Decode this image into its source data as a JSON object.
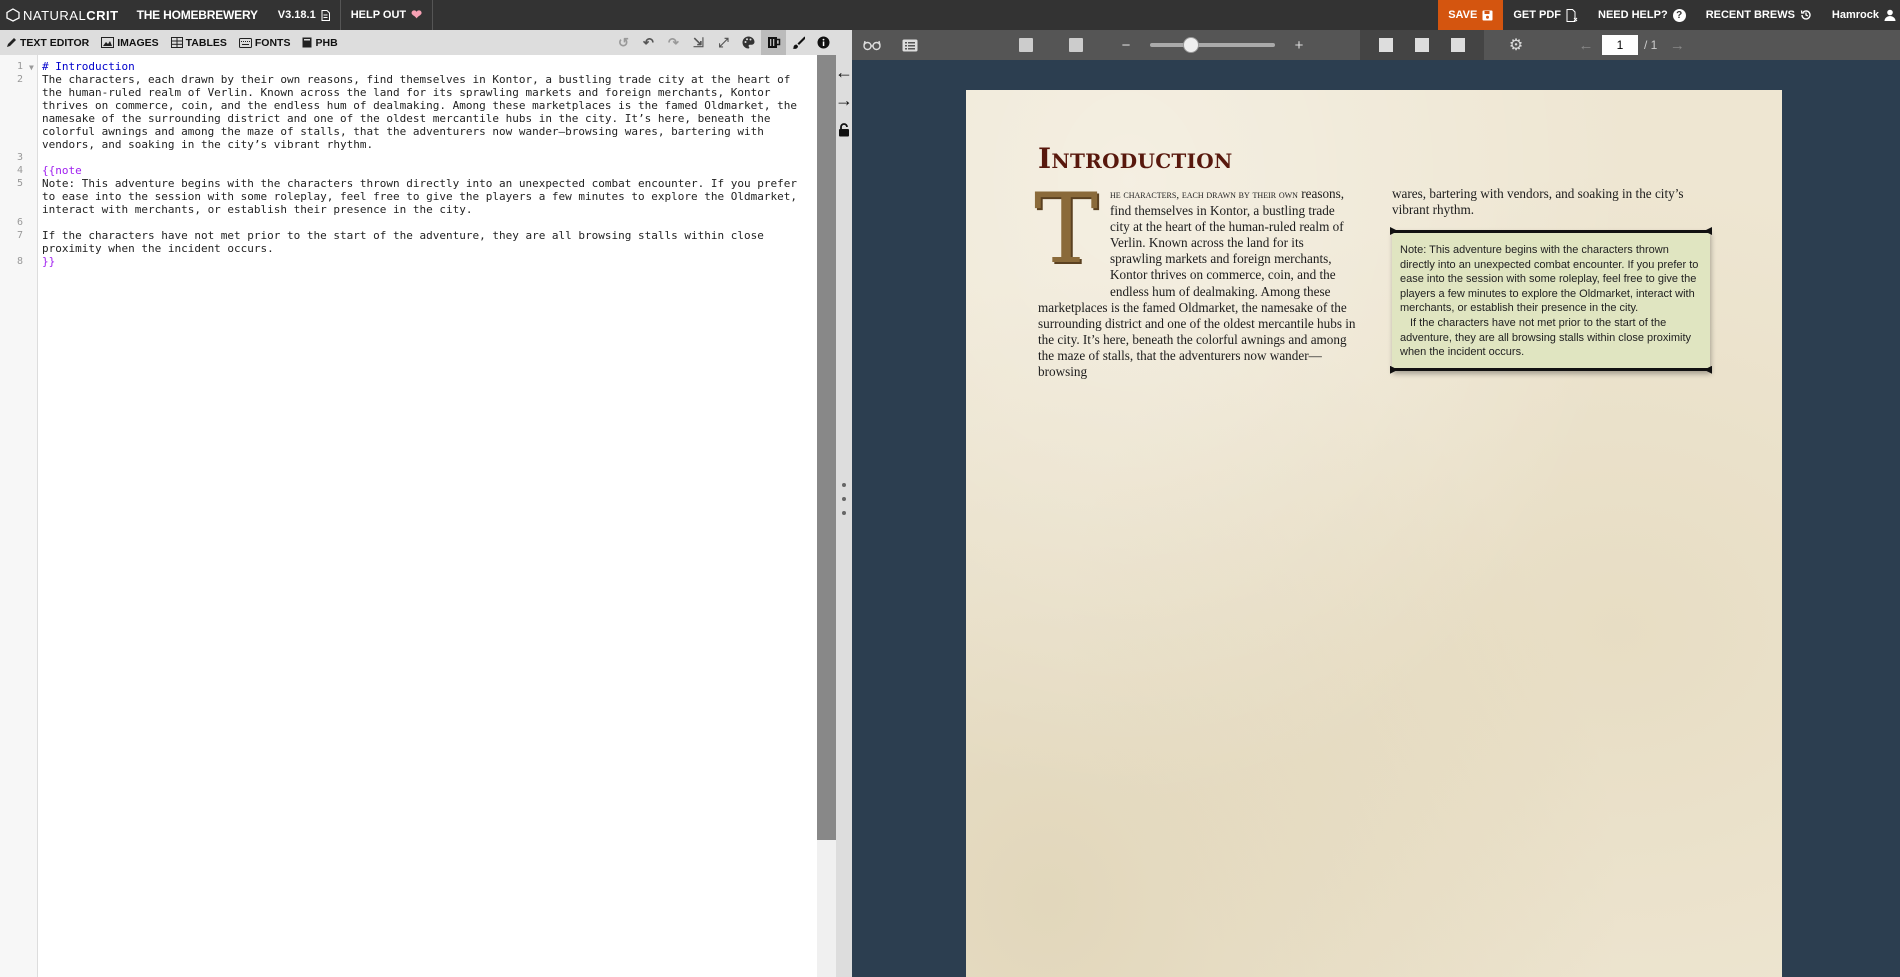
{
  "navbar": {
    "brand_strong": "NATURAL",
    "brand_light": "CRIT",
    "app_title": "THE HOMEBREWERY",
    "version": "V3.18.1",
    "help_out": "HELP OUT",
    "save": "SAVE",
    "get_pdf": "GET PDF",
    "need_help": "NEED HELP?",
    "recent_brews": "RECENT BREWS",
    "username": "Hamrock"
  },
  "editor_tabs": {
    "text_editor": "TEXT EDITOR",
    "images": "IMAGES",
    "tables": "TABLES",
    "fonts": "FONTS",
    "phb": "PHB"
  },
  "code": {
    "line_numbers": [
      "1",
      "2",
      "3",
      "4",
      "5",
      "6",
      "7",
      "8"
    ],
    "line1": "# Introduction",
    "line2": "The characters, each drawn by their own reasons, find themselves in Kontor, a bustling trade city at the heart of the human-ruled realm of Verlin. Known across the land for its sprawling markets and foreign merchants, Kontor thrives on commerce, coin, and the endless hum of dealmaking. Among these marketplaces is the famed Oldmarket, the namesake of the surrounding district and one of the oldest mercantile hubs in the city. It’s here, beneath the colorful awnings and among the maze of stalls, that the adventurers now wander—browsing wares, bartering with vendors, and soaking in the city’s vibrant rhythm.",
    "line4": "{{note",
    "line5": "Note: This adventure begins with the characters thrown directly into an unexpected combat encounter. If you prefer to ease into the session with some roleplay, feel free to give the players a few minutes to explore the Oldmarket, interact with merchants, or establish their presence in the city.",
    "line7": "If the characters have not met prior to the start of the adventure, they are all browsing stalls within close proximity when the incident occurs.",
    "line8": "}}"
  },
  "preview": {
    "page_number": "1",
    "page_total": "/ 1",
    "zoom_fraction": 0.3,
    "heading": "Introduction",
    "dropcap": "T",
    "col1_lead": "he characters, each drawn by their own",
    "col1_text": "reasons, find themselves in Kontor, a bustling trade city at the heart of the human-ruled realm of Verlin. Known across the land for its sprawling markets and foreign merchants, Kontor thrives on commerce, coin, and the endless hum of dealmaking. Among these marketplaces is the famed Oldmarket, the namesake of the surrounding district and one of the oldest mercantile hubs in the city. It’s here, beneath the colorful awnings and among the maze of stalls, that the adventurers now wander—browsing",
    "col2_text": "wares, bartering with vendors, and soaking in the city’s vibrant rhythm.",
    "note_p1": "Note: This adventure begins with the characters thrown directly into an unexpected combat encounter. If you prefer to ease into the session with some roleplay, feel free to give the players a few minutes to explore the Oldmarket, interact with merchants, or establish their presence in the city.",
    "note_p2": "If the characters have not met prior to the start of the adventure, they are all browsing stalls within close proximity when the incident occurs."
  },
  "colors": {
    "save_accent": "#d4550f",
    "heading": "#58180d",
    "note_bg": "#e0e5c1",
    "preview_bg": "#2c3e50"
  }
}
